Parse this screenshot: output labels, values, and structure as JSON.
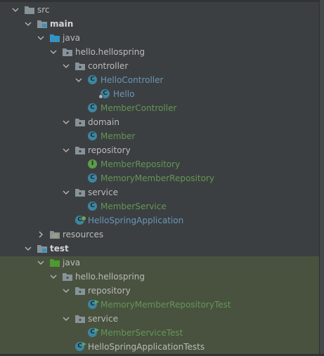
{
  "tree": {
    "src": "src",
    "main": "main",
    "main_java": "java",
    "main_pkg": "hello.hellospring",
    "controller": "controller",
    "hello_controller": "HelloController",
    "hello": "Hello",
    "member_controller": "MemberController",
    "domain": "domain",
    "member": "Member",
    "repository": "repository",
    "member_repository": "MemberRepository",
    "memory_member_repository": "MemoryMemberRepository",
    "service": "service",
    "member_service": "MemberService",
    "hello_spring_application": "HelloSpringApplication",
    "resources": "resources",
    "test": "test",
    "test_java": "java",
    "test_pkg": "hello.hellospring",
    "test_repository": "repository",
    "memory_member_repository_test": "MemoryMemberRepositoryTest",
    "test_service": "service",
    "member_service_test": "MemberServiceTest",
    "hello_spring_application_tests": "HelloSpringApplicationTests"
  },
  "icons": {
    "class_letter": "C",
    "interface_letter": "I"
  },
  "colors": {
    "background": "#3c3f41",
    "test_background": "#49523f",
    "text": "#bbbbbb",
    "added_file": "#629755",
    "modified_file": "#6897bb",
    "folder": "#87939a",
    "source_folder": "#3592c4",
    "test_folder": "#4e9a2f"
  }
}
